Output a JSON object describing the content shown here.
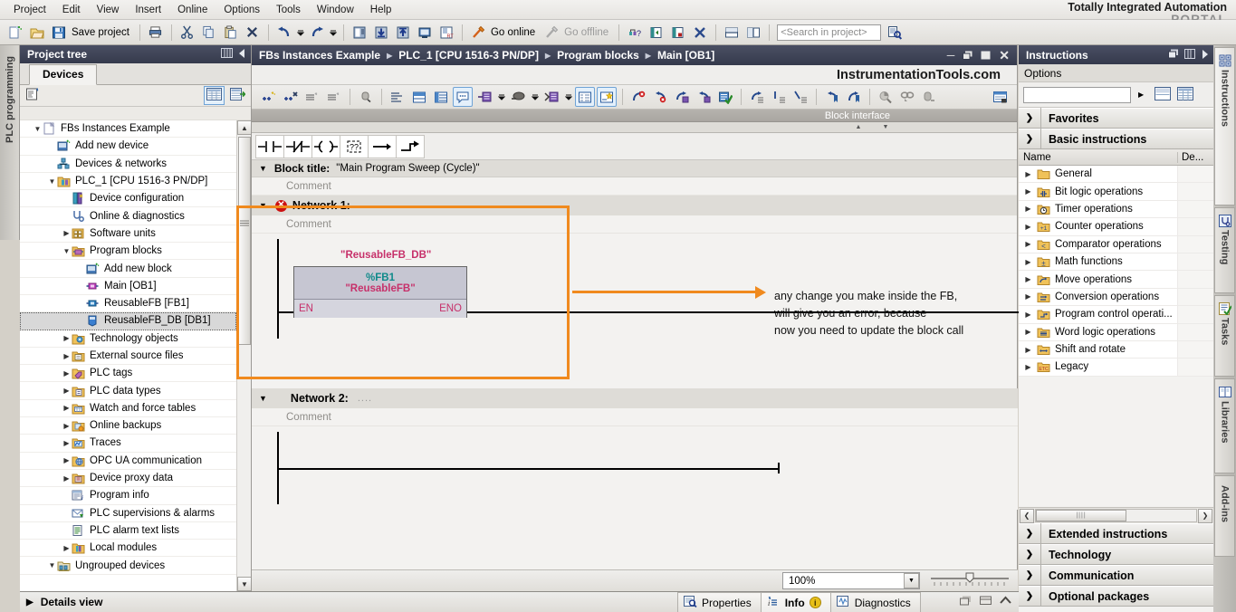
{
  "app": {
    "brand_line1": "Totally Integrated Automation",
    "brand_line2": "PORTAL"
  },
  "menubar": {
    "items": [
      "Project",
      "Edit",
      "View",
      "Insert",
      "Online",
      "Options",
      "Tools",
      "Window",
      "Help"
    ]
  },
  "toolbar": {
    "save_label": "Save project",
    "go_online": "Go online",
    "go_offline": "Go offline",
    "search_placeholder": "<Search in project>",
    "icons": [
      "new-project-icon",
      "open-project-icon",
      "save-icon",
      "print-icon",
      "cut-icon",
      "copy-icon",
      "paste-icon",
      "delete-icon",
      "undo-icon",
      "undo-dropdown-icon",
      "redo-icon",
      "redo-dropdown-icon",
      "compile-icon",
      "download-to-device-icon",
      "upload-from-device-icon",
      "start-simulation-icon",
      "start-runtime-icon",
      "go-online-icon",
      "go-offline-icon",
      "hardware-detect-icon",
      "show-hide-left-icon",
      "show-hide-right-icon",
      "close-view-icon",
      "split-horizontal-icon",
      "split-vertical-icon",
      "search-in-project-icon"
    ]
  },
  "left_vertical_tab": {
    "label": "PLC programming"
  },
  "project_tree": {
    "title": "Project tree",
    "tab": "Devices",
    "toolbar_icons": [
      "tree-filter-icon",
      "list-view-icon",
      "detail-view-icon"
    ],
    "details_view": "Details view",
    "items": [
      {
        "label": "FBs Instances Example",
        "indent": 0,
        "arrow": "open",
        "icon": "project-icon"
      },
      {
        "label": "Add new device",
        "indent": 1,
        "arrow": "none",
        "icon": "add-device-icon"
      },
      {
        "label": "Devices & networks",
        "indent": 1,
        "arrow": "none",
        "icon": "devices-networks-icon"
      },
      {
        "label": "PLC_1 [CPU 1516-3 PN/DP]",
        "indent": 1,
        "arrow": "open",
        "icon": "plc-icon"
      },
      {
        "label": "Device configuration",
        "indent": 2,
        "arrow": "none",
        "icon": "device-config-icon"
      },
      {
        "label": "Online & diagnostics",
        "indent": 2,
        "arrow": "none",
        "icon": "online-diagnostics-icon"
      },
      {
        "label": "Software units",
        "indent": 2,
        "arrow": "closed",
        "icon": "software-units-icon"
      },
      {
        "label": "Program blocks",
        "indent": 2,
        "arrow": "open",
        "icon": "program-blocks-icon"
      },
      {
        "label": "Add new block",
        "indent": 3,
        "arrow": "none",
        "icon": "add-block-icon"
      },
      {
        "label": "Main [OB1]",
        "indent": 3,
        "arrow": "none",
        "icon": "ob-block-icon"
      },
      {
        "label": "ReusableFB [FB1]",
        "indent": 3,
        "arrow": "none",
        "icon": "fb-block-icon"
      },
      {
        "label": "ReusableFB_DB [DB1]",
        "indent": 3,
        "arrow": "none",
        "icon": "db-block-icon",
        "selected": true
      },
      {
        "label": "Technology objects",
        "indent": 2,
        "arrow": "closed",
        "icon": "technology-objects-icon"
      },
      {
        "label": "External source files",
        "indent": 2,
        "arrow": "closed",
        "icon": "external-sources-icon"
      },
      {
        "label": "PLC tags",
        "indent": 2,
        "arrow": "closed",
        "icon": "plc-tags-icon"
      },
      {
        "label": "PLC data types",
        "indent": 2,
        "arrow": "closed",
        "icon": "plc-data-types-icon"
      },
      {
        "label": "Watch and force tables",
        "indent": 2,
        "arrow": "closed",
        "icon": "watch-tables-icon"
      },
      {
        "label": "Online backups",
        "indent": 2,
        "arrow": "closed",
        "icon": "online-backups-icon"
      },
      {
        "label": "Traces",
        "indent": 2,
        "arrow": "closed",
        "icon": "traces-icon"
      },
      {
        "label": "OPC UA communication",
        "indent": 2,
        "arrow": "closed",
        "icon": "opcua-icon"
      },
      {
        "label": "Device proxy data",
        "indent": 2,
        "arrow": "closed",
        "icon": "device-proxy-icon"
      },
      {
        "label": "Program info",
        "indent": 2,
        "arrow": "none",
        "icon": "program-info-icon"
      },
      {
        "label": "PLC supervisions & alarms",
        "indent": 2,
        "arrow": "none",
        "icon": "plc-alarms-icon"
      },
      {
        "label": "PLC alarm text lists",
        "indent": 2,
        "arrow": "none",
        "icon": "alarm-text-lists-icon"
      },
      {
        "label": "Local modules",
        "indent": 2,
        "arrow": "closed",
        "icon": "local-modules-icon"
      },
      {
        "label": "Ungrouped devices",
        "indent": 1,
        "arrow": "open",
        "icon": "ungrouped-devices-icon"
      }
    ]
  },
  "editor": {
    "breadcrumb": [
      "FBs Instances Example",
      "PLC_1 [CPU 1516-3 PN/DP]",
      "Program blocks",
      "Main [OB1]"
    ],
    "window_buttons": [
      "minimize",
      "restore",
      "maximize",
      "close"
    ],
    "watermark": "InstrumentationTools.com",
    "block_interface_label": "Block interface",
    "ladder_palette": [
      "no-contact-icon",
      "nc-contact-icon",
      "coil-icon",
      "empty-box-icon",
      "branch-open-icon",
      "branch-close-icon"
    ],
    "block_title_label": "Block title:",
    "block_title_value": "\"Main Program Sweep (Cycle)\"",
    "comment_placeholder": "Comment",
    "networks": [
      {
        "name": "Network 1:",
        "dots": "....",
        "has_error": true,
        "comment": "Comment"
      },
      {
        "name": "Network 2:",
        "dots": "....",
        "has_error": false,
        "comment": "Comment"
      }
    ],
    "fb_call": {
      "db_name": "\"ReusableFB_DB\"",
      "fb_number": "%FB1",
      "fb_name": "\"ReusableFB\"",
      "en": "EN",
      "eno": "ENO"
    },
    "annotation": {
      "line1": "any change you make inside the FB,",
      "line2": "will give you an error, because",
      "line3": "now you need to update the block call",
      "highlight_color": "#f08a1e"
    },
    "zoom_value": "100%"
  },
  "instructions": {
    "title": "Instructions",
    "options_label": "Options",
    "search_value": "",
    "columns": [
      "Name",
      "De..."
    ],
    "sections": [
      {
        "label": "Favorites",
        "expanded": false
      },
      {
        "label": "Basic instructions",
        "expanded": true
      }
    ],
    "basic_items": [
      {
        "label": "General",
        "icon": "folder-icon"
      },
      {
        "label": "Bit logic operations",
        "icon": "bit-logic-icon"
      },
      {
        "label": "Timer operations",
        "icon": "timer-icon"
      },
      {
        "label": "Counter operations",
        "icon": "counter-icon"
      },
      {
        "label": "Comparator operations",
        "icon": "comparator-icon"
      },
      {
        "label": "Math functions",
        "icon": "math-icon"
      },
      {
        "label": "Move operations",
        "icon": "move-icon"
      },
      {
        "label": "Conversion operations",
        "icon": "conversion-icon"
      },
      {
        "label": "Program control operati...",
        "icon": "program-control-icon"
      },
      {
        "label": "Word logic operations",
        "icon": "word-logic-icon"
      },
      {
        "label": "Shift and rotate",
        "icon": "shift-rotate-icon"
      },
      {
        "label": "Legacy",
        "icon": "legacy-icon"
      }
    ],
    "bottom_sections": [
      {
        "label": "Extended instructions"
      },
      {
        "label": "Technology"
      },
      {
        "label": "Communication"
      },
      {
        "label": "Optional packages"
      }
    ]
  },
  "right_tabs": [
    {
      "label": "Instructions",
      "icon": "instructions-icon",
      "active": true
    },
    {
      "label": "Testing",
      "icon": "testing-icon",
      "active": false
    },
    {
      "label": "Tasks",
      "icon": "tasks-icon",
      "active": false
    },
    {
      "label": "Libraries",
      "icon": "libraries-icon",
      "active": false
    },
    {
      "label": "Add-ins",
      "icon": "addins-icon",
      "active": false
    }
  ],
  "statusbar": {
    "tabs": [
      {
        "label": "Properties",
        "icon": "properties-icon"
      },
      {
        "label": "Info",
        "icon": "info-icon",
        "badge": "i"
      },
      {
        "label": "Diagnostics",
        "icon": "diagnostics-icon"
      }
    ]
  }
}
